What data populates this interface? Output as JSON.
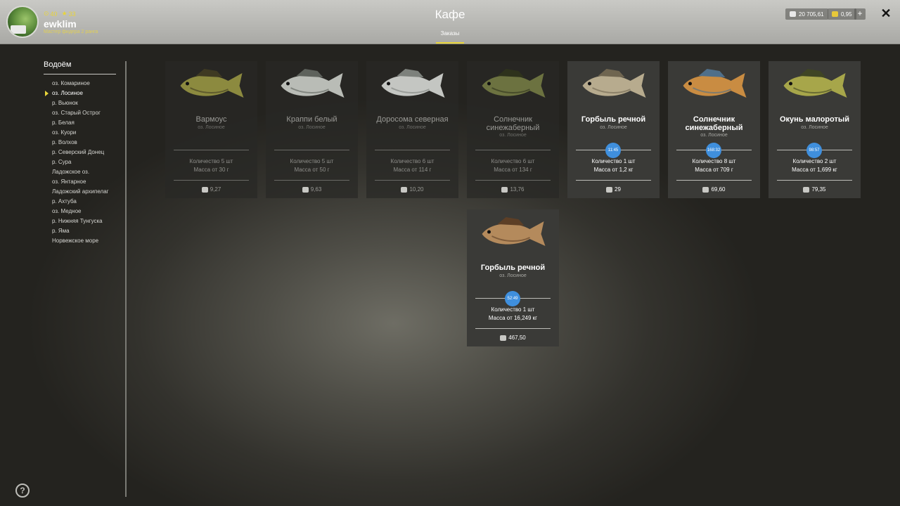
{
  "player": {
    "level": "40",
    "stars": "33",
    "username": "ewklim",
    "rank": "Мастер фидера 2 ранга"
  },
  "title": "Кафе",
  "tab": "Заказы",
  "currency": {
    "silver": "20 705,61",
    "gold": "0,95",
    "plus": "+"
  },
  "close": "✕",
  "sidebar": {
    "title": "Водоём",
    "items": [
      {
        "label": "оз. Комариное"
      },
      {
        "label": "оз. Лосиное",
        "active": true
      },
      {
        "label": "р. Вьюнок"
      },
      {
        "label": "оз. Старый Острог"
      },
      {
        "label": "р. Белая"
      },
      {
        "label": "оз. Куори"
      },
      {
        "label": "р. Волхов"
      },
      {
        "label": "р. Северский Донец"
      },
      {
        "label": "р. Сура"
      },
      {
        "label": "Ладожское оз."
      },
      {
        "label": "оз. Янтарное"
      },
      {
        "label": "Ладожский архипелаг"
      },
      {
        "label": "р. Ахтуба"
      },
      {
        "label": "оз. Медное"
      },
      {
        "label": "р. Нижняя Тунгуска"
      },
      {
        "label": "р. Яма"
      },
      {
        "label": "Норвежское море"
      }
    ]
  },
  "help": "?",
  "orders": [
    {
      "fish": "Вармоус",
      "location": "оз. Лосиное",
      "quantity": "Количество 5 шт",
      "mass": "Масса от 30 г",
      "price": "9,27",
      "active": false,
      "colors": [
        "#8c8a3f",
        "#3f3a22"
      ]
    },
    {
      "fish": "Краппи белый",
      "location": "оз. Лосиное",
      "quantity": "Количество 5 шт",
      "mass": "Масса от 50 г",
      "price": "9,63",
      "active": false,
      "colors": [
        "#b9bcb6",
        "#5e625c"
      ]
    },
    {
      "fish": "Доросома северная",
      "location": "оз. Лосиное",
      "quantity": "Количество 6 шт",
      "mass": "Масса от 114 г",
      "price": "10,20",
      "active": false,
      "colors": [
        "#c4c6c2",
        "#7d817c"
      ]
    },
    {
      "fish": "Солнечник синежаберный",
      "location": "оз. Лосиное",
      "quantity": "Количество 6 шт",
      "mass": "Масса от 134 г",
      "price": "13,76",
      "active": false,
      "colors": [
        "#6c7240",
        "#2e321c"
      ]
    },
    {
      "fish": "Горбыль речной",
      "location": "оз. Лосиное",
      "timer": "11:45",
      "quantity": "Количество 1 шт",
      "mass": "Масса от 1,2 кг",
      "price": "29",
      "active": true,
      "colors": [
        "#b7ab8e",
        "#6f6550"
      ]
    },
    {
      "fish": "Солнечник синежаберный",
      "location": "оз. Лосиное",
      "timer": "168:32",
      "quantity": "Количество 8 шт",
      "mass": "Масса от 709 г",
      "price": "69,60",
      "active": true,
      "colors": [
        "#c98c42",
        "#4f6f8a"
      ]
    },
    {
      "fish": "Окунь малоротый",
      "location": "оз. Лосиное",
      "timer": "98:57",
      "quantity": "Количество 2 шт",
      "mass": "Масса от 1,699 кг",
      "price": "79,35",
      "active": true,
      "colors": [
        "#a7a64a",
        "#3f4524"
      ]
    },
    {
      "fish": "Горбыль речной",
      "location": "оз. Лосиное",
      "timer": "52:49",
      "quantity": "Количество 1 шт",
      "mass": "Масса от 16,249 кг",
      "price": "467,50",
      "active": true,
      "colors": [
        "#b48a5c",
        "#5d3f26"
      ]
    }
  ]
}
